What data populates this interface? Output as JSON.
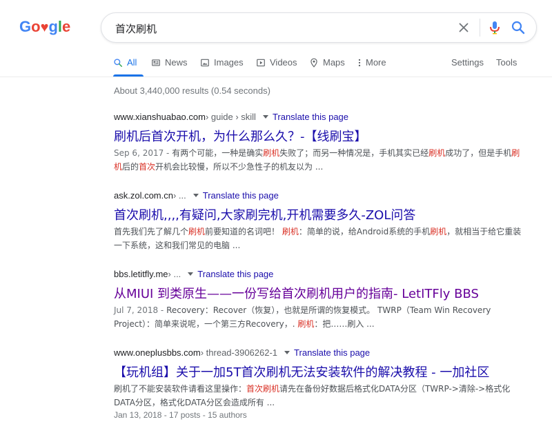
{
  "logo": {
    "text": "Google"
  },
  "search": {
    "query": "首次刷机"
  },
  "tabs": [
    {
      "label": "All",
      "icon": "search-icon"
    },
    {
      "label": "News",
      "icon": "news-icon"
    },
    {
      "label": "Images",
      "icon": "image-icon"
    },
    {
      "label": "Videos",
      "icon": "video-icon"
    },
    {
      "label": "Maps",
      "icon": "map-pin-icon"
    },
    {
      "label": "More",
      "icon": "more-vert-icon"
    }
  ],
  "tools": {
    "settings": "Settings",
    "tools": "Tools"
  },
  "stats": "About 3,440,000 results (0.54 seconds)",
  "colors": {
    "link": "#1a0dab",
    "visited": "#660099",
    "accent": "#1a73e8",
    "highlight": "#d93025"
  },
  "results": [
    {
      "site": "www.xianshuabao.com",
      "breadcrumb": " › guide › skill",
      "translate": "Translate this page",
      "title": "刷机后首次开机，为什么那么久？-【线刷宝】",
      "date": "Sep 6, 2017 - ",
      "snippet": [
        {
          "t": "有两个可能，一种是确实",
          "hl": false
        },
        {
          "t": "刷机",
          "hl": true
        },
        {
          "t": "失败了；而另一种情况是，手机其实已经",
          "hl": false
        },
        {
          "t": "刷机",
          "hl": true
        },
        {
          "t": "成功了，但是手机",
          "hl": false
        },
        {
          "t": "刷机",
          "hl": true
        },
        {
          "t": "后的",
          "hl": false
        },
        {
          "t": "首次",
          "hl": true
        },
        {
          "t": "开机会比较慢，所以不少急性子的机友以为 ...",
          "hl": false
        }
      ]
    },
    {
      "site": "ask.zol.com.cn",
      "breadcrumb": " › ...",
      "translate": "Translate this page",
      "title": "首次刷机,,,,有疑问,大家刷完机,开机需要多久-ZOL问答",
      "date": "",
      "snippet": [
        {
          "t": "首先我们先了解几个",
          "hl": false
        },
        {
          "t": "刷机",
          "hl": true
        },
        {
          "t": "前要知道的名词吧！ ",
          "hl": false
        },
        {
          "t": "刷机",
          "hl": true
        },
        {
          "t": "：简单的说，给Android系统的手机",
          "hl": false
        },
        {
          "t": "刷机",
          "hl": true
        },
        {
          "t": "，就相当于给它重装一下系统，这和我们常见的电脑 ...",
          "hl": false
        }
      ]
    },
    {
      "site": "bbs.letitfly.me",
      "breadcrumb": " › ...",
      "translate": "Translate this page",
      "title": "从MIUI 到类原生——一份写给首次刷机用户的指南- LetITFly BBS",
      "date": "Jul 7, 2018 - ",
      "snippet": [
        {
          "t": "Recovery：Recover（恢复），也就是所谓的恢复模式。 TWRP（Team Win Recovery Project）：简单来说呢，一个第三方Recovery，. ",
          "hl": false
        },
        {
          "t": "刷机",
          "hl": true
        },
        {
          "t": "：把……刷入 ...",
          "hl": false
        }
      ]
    },
    {
      "site": "www.oneplusbbs.com",
      "breadcrumb": " › thread-3906262-1",
      "translate": "Translate this page",
      "title": "【玩机组】关于一加5T首次刷机无法安装软件的解决教程 - 一加社区",
      "date": "",
      "snippet": [
        {
          "t": "刷机了不能安装软件请看这里操作：",
          "hl": false
        },
        {
          "t": "首次刷机",
          "hl": true
        },
        {
          "t": "请先在备份好数据后格式化DATA分区（TWRP->清除->格式化DATA分区，格式化DATA分区会造成所有 ...",
          "hl": false
        }
      ],
      "meta": "Jan 13, 2018 - 17 posts - 15 authors"
    }
  ]
}
